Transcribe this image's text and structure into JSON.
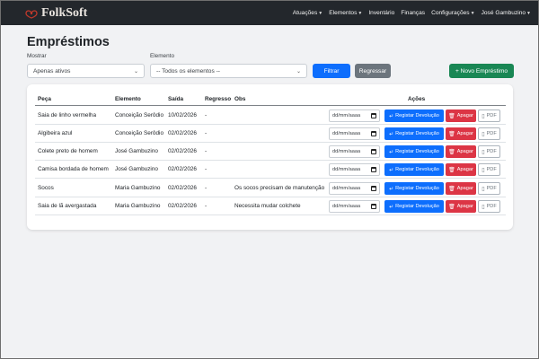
{
  "navbar": {
    "brand": "FolkSoft",
    "items": [
      {
        "label": "Atuações",
        "dropdown": true
      },
      {
        "label": "Elementos",
        "dropdown": true
      },
      {
        "label": "Inventário",
        "dropdown": false
      },
      {
        "label": "Finanças",
        "dropdown": false
      },
      {
        "label": "Configurações",
        "dropdown": true
      },
      {
        "label": "José Gambuzino",
        "dropdown": true
      }
    ]
  },
  "page": {
    "title": "Empréstimos"
  },
  "filters": {
    "show_label": "Mostrar",
    "show_value": "Apenas ativos",
    "element_label": "Elemento",
    "element_value": "-- Todos os elementos --",
    "filter_button": "Filtrar",
    "back_button": "Regressar",
    "new_button": "+ Novo Empréstimo"
  },
  "table": {
    "headers": [
      "Peça",
      "Elemento",
      "Saída",
      "Regresso",
      "Obs",
      "Ações"
    ],
    "date_placeholder": "dd/mm/aaaa",
    "return_label": "Registar Devolução",
    "delete_label": "Apagar",
    "pdf_label": "PDF",
    "rows": [
      {
        "peca": "Saia de linho vermelha",
        "elemento": "Conceição Serôdio",
        "saida": "10/02/2026",
        "regresso": "-",
        "obs": ""
      },
      {
        "peca": "Algibeira azul",
        "elemento": "Conceição Serôdio",
        "saida": "02/02/2026",
        "regresso": "-",
        "obs": ""
      },
      {
        "peca": "Colete preto de homem",
        "elemento": "José Gambuzino",
        "saida": "02/02/2026",
        "regresso": "-",
        "obs": ""
      },
      {
        "peca": "Camisa bordada de homem",
        "elemento": "José Gambuzino",
        "saida": "02/02/2026",
        "regresso": "-",
        "obs": ""
      },
      {
        "peca": "Socos",
        "elemento": "Maria Gambuzino",
        "saida": "02/02/2026",
        "regresso": "-",
        "obs": "Os socos precisam de manutenção"
      },
      {
        "peca": "Saia de lã avergastada",
        "elemento": "Maria Gambuzino",
        "saida": "02/02/2026",
        "regresso": "-",
        "obs": "Necessita mudar colchete"
      }
    ]
  },
  "colors": {
    "navbar_bg": "#23272c",
    "primary": "#0d6efd",
    "secondary": "#6c757d",
    "success": "#198754",
    "danger": "#dc3545",
    "brand_icon": "#c0392b"
  }
}
